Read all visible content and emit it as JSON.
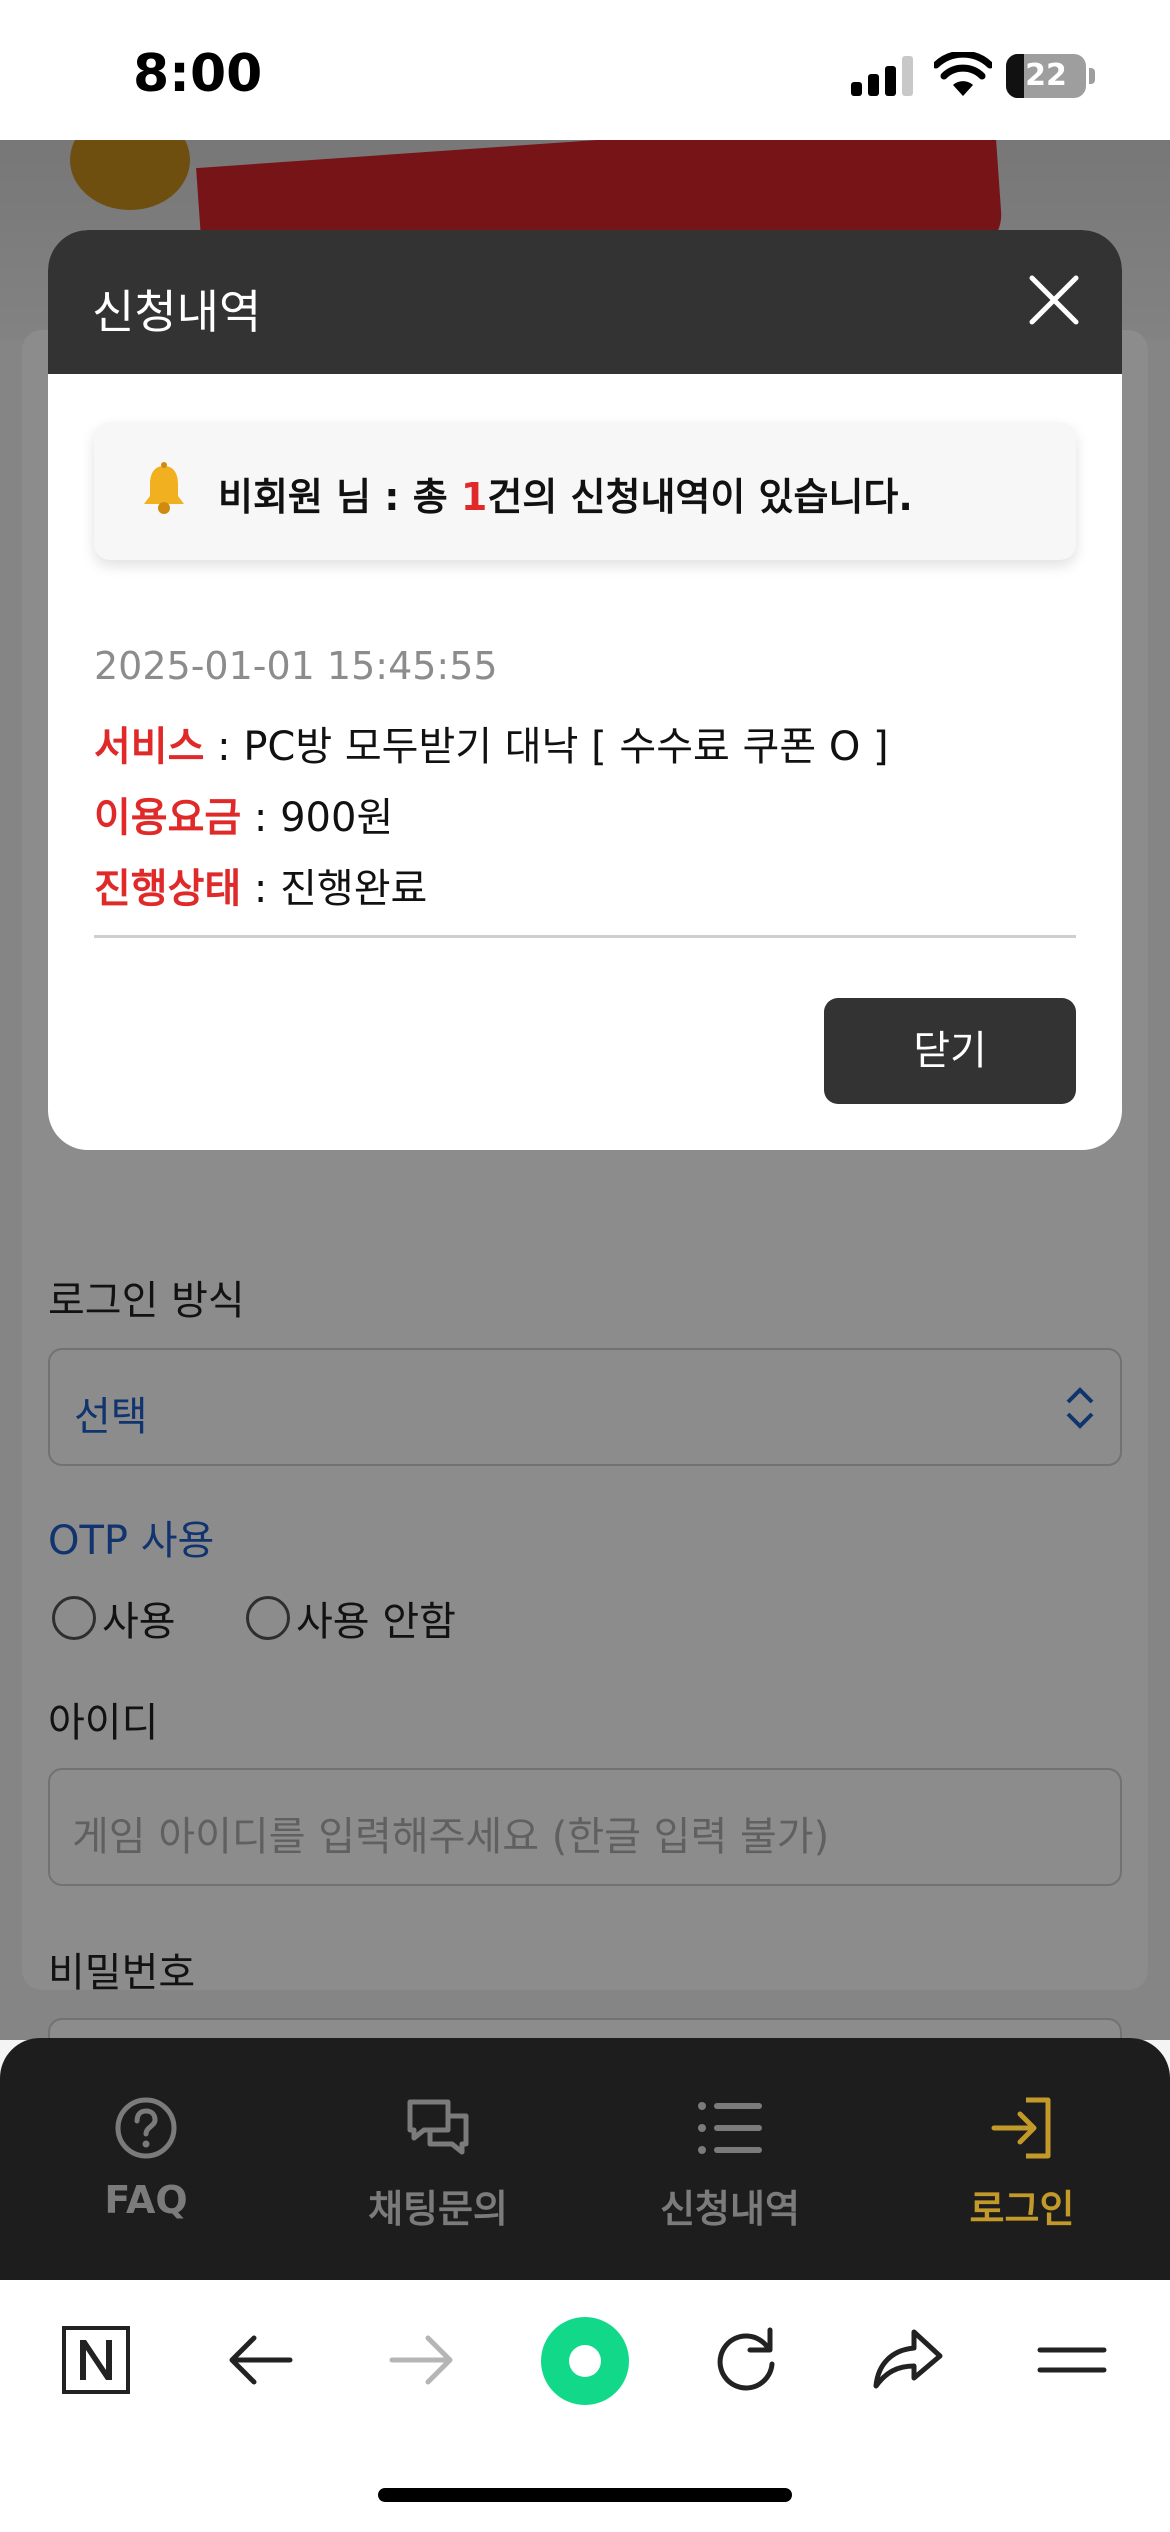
{
  "status_bar": {
    "time": "8:00",
    "battery": "22"
  },
  "login_form": {
    "login_method_label": "로그인 방식",
    "login_method_value": "선택",
    "otp_label": "OTP 사용",
    "otp_options": [
      "사용",
      "사용 안함"
    ],
    "id_label": "아이디",
    "id_placeholder": "게임 아이디를 입력해주세요 (한글 입력 불가)",
    "password_label": "비밀번호"
  },
  "modal": {
    "title": "신청내역",
    "notice_prefix": "비회원 님 : 총 ",
    "notice_count": "1",
    "notice_suffix": "건의 신청내역이 있습니다.",
    "entry": {
      "date": "2025-01-01 15:45:55",
      "service_key": "서비스",
      "service_value": " : PC방 모두받기 대낙 [ 수수료 쿠폰 O ]",
      "fee_key": "이용요금",
      "fee_value": " : 900원",
      "status_key": "진행상태",
      "status_value": " : 진행완료"
    },
    "close_button": "닫기"
  },
  "tabbar": {
    "items": [
      {
        "label": "FAQ",
        "icon": "question-circle-icon"
      },
      {
        "label": "채팅문의",
        "icon": "chat-bubbles-icon"
      },
      {
        "label": "신청내역",
        "icon": "list-icon"
      },
      {
        "label": "로그인",
        "icon": "login-icon"
      }
    ],
    "active_color": "#c39a2a"
  },
  "browser_toolbar": {
    "icons": [
      "naver-n-icon",
      "back-arrow-icon",
      "forward-arrow-icon",
      "green-dot-icon",
      "reload-icon",
      "share-icon",
      "menu-icon"
    ]
  },
  "colors": {
    "accent_red": "#e02a2a",
    "link_blue": "#1f5fc9",
    "dark": "#333333"
  }
}
